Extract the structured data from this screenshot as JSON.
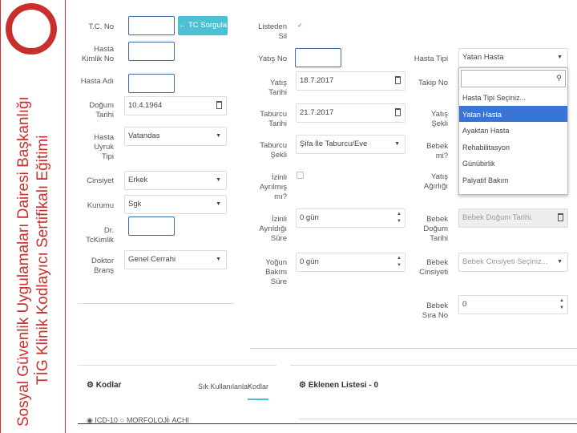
{
  "sidebar": {
    "title_line1": "Sosyal Güvenlik Uygulamaları Dairesi Başkanlığı",
    "title_line2": "TİG Klinik Kodlayıcı Sertifikalı Eğitimi"
  },
  "form": {
    "tc_no": "T.C. No",
    "tc_button": "TC Sorgula",
    "hasta_kimlik": "Hasta Kimlik No",
    "hasta_adi": "Hasta Adı",
    "dogum_tarihi": "Doğum Tarihi",
    "dogum_value": "10.4.1964",
    "uyruk": "Hasta Uyruk Tipi",
    "uyruk_value": "Vatandas",
    "cinsiyet": "Cinsiyet",
    "cinsiyet_value": "Erkek",
    "kurumu": "Kurumu",
    "kurumu_value": "Sgk",
    "dr": "Dr. TcKimlik",
    "doktor_brans": "Doktor Branş",
    "brans_value": "Genel Cerrahi",
    "listeden_sil": "Listeden Sil",
    "yatis_no": "Yatış No",
    "yatis_tarihi": "Yatış Tarihi",
    "yatis_value": "18.7.2017",
    "taburcu_tarihi": "Taburcu Tarihi",
    "taburcu_value": "21.7.2017",
    "taburcu_sekli": "Taburcu Şekli",
    "taburcu_sekli_value": "Şifa İle Taburcu/Eve",
    "izinli": "İzinli Ayrılmış mı?",
    "izinli_sure": "İzinli Ayrıldığı Süre",
    "izinli_sure_value": "0 gün",
    "yogun": "Yoğun Bakım Süre",
    "yogun_value": "0 gün",
    "hasta_tipi": "Hasta Tipi",
    "hasta_tipi_value": "Yatan Hasta",
    "takip_no": "Takip No",
    "yatis_sekli": "Yatış Şekli",
    "bebek_mi": "Bebek mi?",
    "yatis_agirligi": "Yatış Ağırlığı",
    "bebek_dogum": "Bebek Doğum Tarihi",
    "bebek_dogum_ph": "Bebek Doğum Tarihi.",
    "bebek_cinsiyet": "Bebek Cinsiyeti",
    "bebek_cinsiyet_ph": "Bebek Cinsiyeti Seçiniz...",
    "bebek_sira": "Bebek Sıra No",
    "bebek_sira_value": "0"
  },
  "dropdown": {
    "options": [
      "Hasta Tipi Seçiniz...",
      "Yatan Hasta",
      "Ayaktan Hasta",
      "Rehabilitasyon",
      "Günübirlik",
      "Palyatif Bakım"
    ],
    "selected_index": 1
  },
  "bottom": {
    "kodlar": "Kodlar",
    "sik": "Sık Kullanılanlar",
    "kodlar_tab": "Kodlar",
    "eklenen": "Eklenen Listesi - 0",
    "radio1": "ICD-10",
    "radio2": "MORFOLOJİ",
    "radio3": "ACHI"
  },
  "colors": {
    "accent": "#c9302c",
    "button": "#4cc0d5",
    "selected": "#3875d7"
  }
}
